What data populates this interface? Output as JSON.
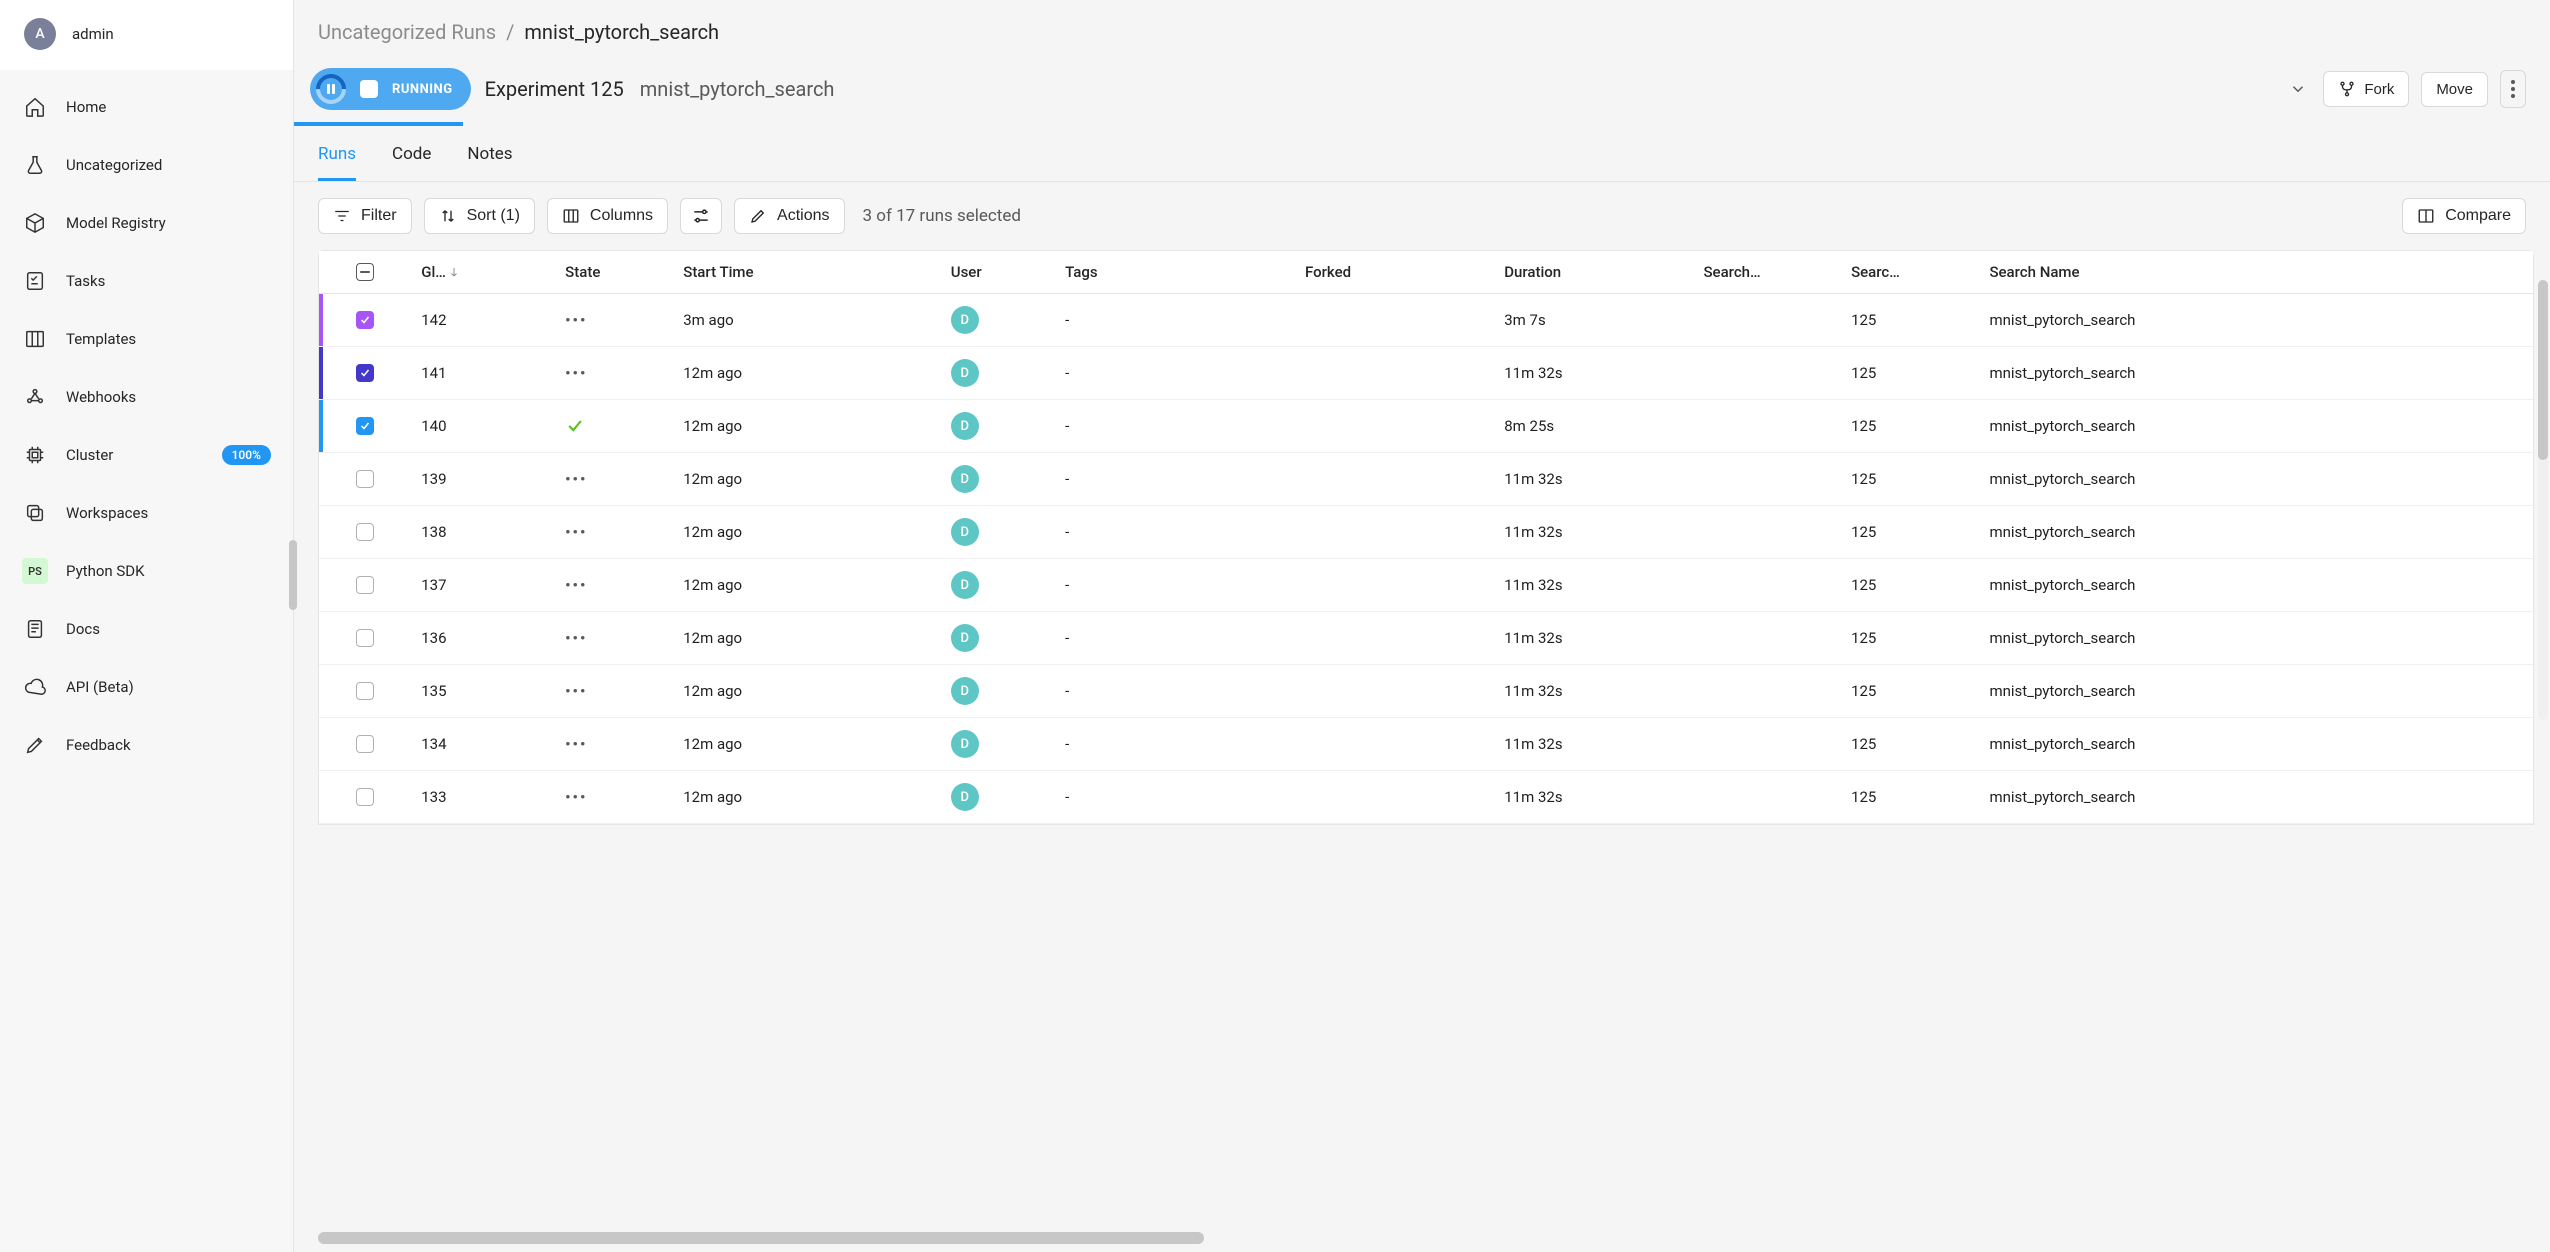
{
  "user": {
    "avatar_letter": "A",
    "name": "admin"
  },
  "sidebar": {
    "items": [
      {
        "label": "Home"
      },
      {
        "label": "Uncategorized"
      },
      {
        "label": "Model Registry"
      },
      {
        "label": "Tasks"
      },
      {
        "label": "Templates"
      },
      {
        "label": "Webhooks"
      },
      {
        "label": "Cluster",
        "badge": "100%"
      },
      {
        "label": "Workspaces"
      },
      {
        "label": "Python SDK"
      },
      {
        "label": "Docs"
      },
      {
        "label": "API (Beta)"
      },
      {
        "label": "Feedback"
      }
    ]
  },
  "breadcrumb": {
    "parent": "Uncategorized Runs",
    "sep": "/",
    "current": "mnist_pytorch_search"
  },
  "header": {
    "status": "RUNNING",
    "exp_title": "Experiment 125",
    "exp_name": "mnist_pytorch_search",
    "fork_label": "Fork",
    "move_label": "Move"
  },
  "tabs": [
    {
      "label": "Runs",
      "active": true
    },
    {
      "label": "Code",
      "active": false
    },
    {
      "label": "Notes",
      "active": false
    }
  ],
  "toolbar": {
    "filter": "Filter",
    "sort": "Sort (1)",
    "columns": "Columns",
    "actions": "Actions",
    "selected_text": "3 of 17 runs selected",
    "compare": "Compare"
  },
  "table": {
    "columns": {
      "global": "Gl…",
      "state": "State",
      "start": "Start Time",
      "user": "User",
      "tags": "Tags",
      "forked": "Forked",
      "duration": "Duration",
      "searcher": "Search…",
      "search_id": "Searc…",
      "search_name": "Search Name"
    },
    "rows": [
      {
        "checked": true,
        "accent": "purple",
        "chk_class": "c-purple",
        "global": "142",
        "state": "dots",
        "start": "3m ago",
        "user": "D",
        "tags": "-",
        "forked": "",
        "duration": "3m 7s",
        "searcher": "",
        "search_id": "125",
        "search_name": "mnist_pytorch_search"
      },
      {
        "checked": true,
        "accent": "indigo",
        "chk_class": "c-indigo",
        "global": "141",
        "state": "dots",
        "start": "12m ago",
        "user": "D",
        "tags": "-",
        "forked": "",
        "duration": "11m 32s",
        "searcher": "",
        "search_id": "125",
        "search_name": "mnist_pytorch_search"
      },
      {
        "checked": true,
        "accent": "blue",
        "chk_class": "c-blue",
        "global": "140",
        "state": "check",
        "start": "12m ago",
        "user": "D",
        "tags": "-",
        "forked": "",
        "duration": "8m 25s",
        "searcher": "",
        "search_id": "125",
        "search_name": "mnist_pytorch_search"
      },
      {
        "checked": false,
        "global": "139",
        "state": "dots",
        "start": "12m ago",
        "user": "D",
        "tags": "-",
        "forked": "",
        "duration": "11m 32s",
        "searcher": "",
        "search_id": "125",
        "search_name": "mnist_pytorch_search"
      },
      {
        "checked": false,
        "global": "138",
        "state": "dots",
        "start": "12m ago",
        "user": "D",
        "tags": "-",
        "forked": "",
        "duration": "11m 32s",
        "searcher": "",
        "search_id": "125",
        "search_name": "mnist_pytorch_search"
      },
      {
        "checked": false,
        "global": "137",
        "state": "dots",
        "start": "12m ago",
        "user": "D",
        "tags": "-",
        "forked": "",
        "duration": "11m 32s",
        "searcher": "",
        "search_id": "125",
        "search_name": "mnist_pytorch_search"
      },
      {
        "checked": false,
        "global": "136",
        "state": "dots",
        "start": "12m ago",
        "user": "D",
        "tags": "-",
        "forked": "",
        "duration": "11m 32s",
        "searcher": "",
        "search_id": "125",
        "search_name": "mnist_pytorch_search"
      },
      {
        "checked": false,
        "global": "135",
        "state": "dots",
        "start": "12m ago",
        "user": "D",
        "tags": "-",
        "forked": "",
        "duration": "11m 32s",
        "searcher": "",
        "search_id": "125",
        "search_name": "mnist_pytorch_search"
      },
      {
        "checked": false,
        "global": "134",
        "state": "dots",
        "start": "12m ago",
        "user": "D",
        "tags": "-",
        "forked": "",
        "duration": "11m 32s",
        "searcher": "",
        "search_id": "125",
        "search_name": "mnist_pytorch_search"
      },
      {
        "checked": false,
        "global": "133",
        "state": "dots",
        "start": "12m ago",
        "user": "D",
        "tags": "-",
        "forked": "",
        "duration": "11m 32s",
        "searcher": "",
        "search_id": "125",
        "search_name": "mnist_pytorch_search"
      }
    ]
  }
}
